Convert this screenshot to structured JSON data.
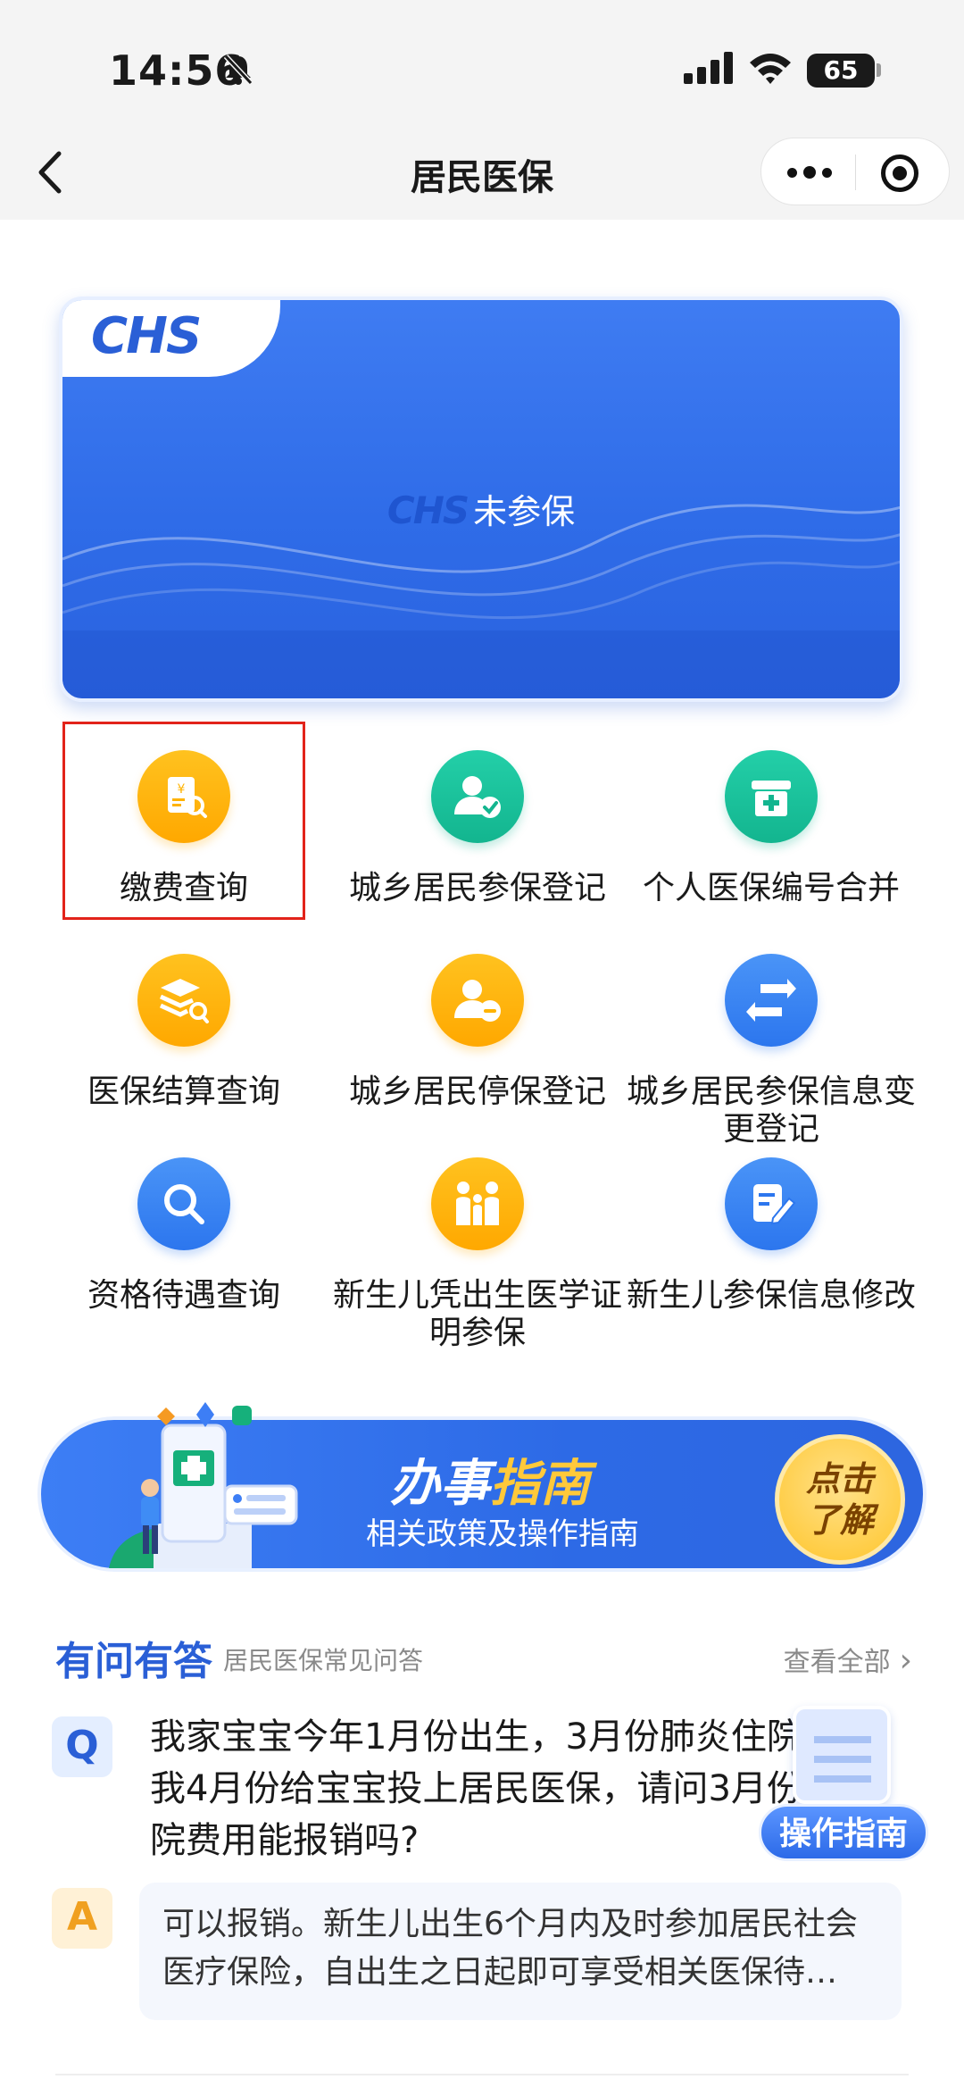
{
  "status_bar": {
    "time": "14:56",
    "battery": "65"
  },
  "nav": {
    "title": "居民医保"
  },
  "card": {
    "logo": "CHS",
    "status": "未参保"
  },
  "services": [
    {
      "label": "缴费查询",
      "icon": "payment-query-icon"
    },
    {
      "label": "城乡居民参保登记",
      "icon": "person-check-icon"
    },
    {
      "label": "个人医保编号合并",
      "icon": "medical-kit-icon"
    },
    {
      "label": "医保结算查询",
      "icon": "settlement-query-icon"
    },
    {
      "label": "城乡居民停保登记",
      "icon": "person-remove-icon"
    },
    {
      "label": "城乡居民参保信息变更登记",
      "icon": "swap-arrows-icon"
    },
    {
      "label": "资格待遇查询",
      "icon": "search-icon"
    },
    {
      "label": "新生儿凭出生医学证明参保",
      "icon": "family-icon"
    },
    {
      "label": "新生儿参保信息修改",
      "icon": "edit-document-icon"
    }
  ],
  "guide_banner": {
    "title_part1": "办事",
    "title_part2": "指南",
    "subtitle": "相关政策及操作指南",
    "button_line1": "点击",
    "button_line2": "了解"
  },
  "qa": {
    "title": "有问有答",
    "subtitle": "居民医保常见问答",
    "view_all": "查看全部",
    "question": "我家宝宝今年1月份出生，3月份肺炎住院，但我4月份给宝宝投上居民医保，请问3月份的住院费用能报销吗?",
    "answer": "可以报销。新生儿出生6个月内及时参加居民社会医疗保险，自出生之日起即可享受相关医保待…",
    "q_badge": "Q",
    "a_badge": "A"
  },
  "floating": {
    "label": "操作指南"
  },
  "colors": {
    "primary": "#2a5fd6",
    "orange": "#ffb300",
    "teal": "#13b58f",
    "blue": "#2c76ee",
    "highlight": "#e2231a"
  }
}
